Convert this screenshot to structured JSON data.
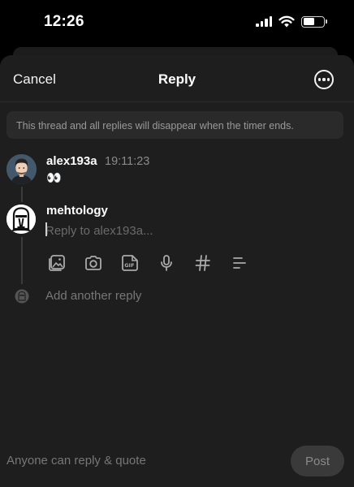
{
  "status_bar": {
    "time": "12:26",
    "battery_level": 0.55
  },
  "header": {
    "cancel_label": "Cancel",
    "title": "Reply",
    "more_icon": "more-horizontal-icon"
  },
  "notice": "This thread and all replies will disappear when the timer ends.",
  "original_post": {
    "username": "alex193a",
    "timestamp": "19:11:23",
    "content": "👀"
  },
  "reply": {
    "username": "mehtology",
    "placeholder": "Reply to alex193a..."
  },
  "toolbar": [
    "gallery-icon",
    "camera-icon",
    "gif-icon",
    "mic-icon",
    "hashtag-icon",
    "poll-icon"
  ],
  "add_reply_label": "Add another reply",
  "footer": {
    "audience": "Anyone can reply & quote",
    "post_label": "Post"
  },
  "colors": {
    "sheet": "#1e1e1e",
    "text_muted": "#777777",
    "post_button": "#3a3a3a"
  }
}
